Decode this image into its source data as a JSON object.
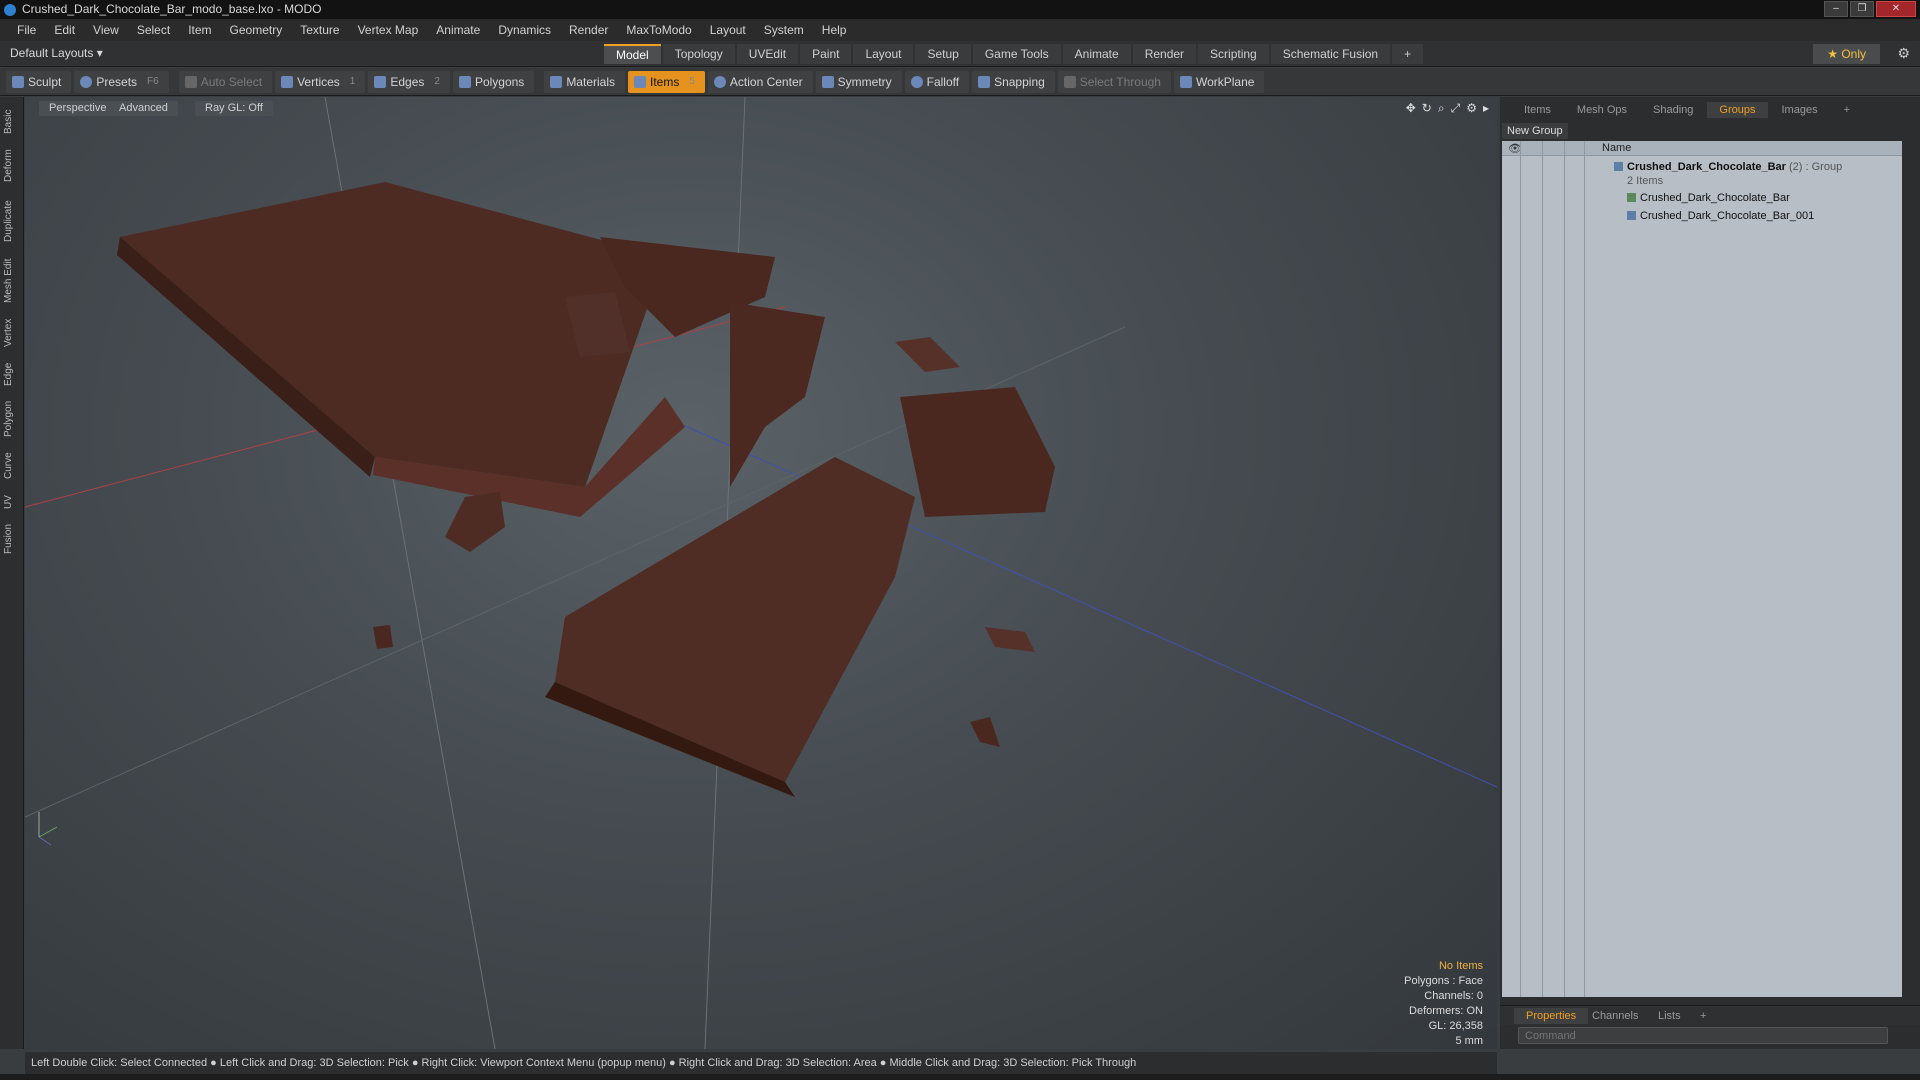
{
  "window": {
    "title": "Crushed_Dark_Chocolate_Bar_modo_base.lxo - MODO",
    "min": "‒",
    "max": "❐",
    "close": "✕"
  },
  "menu": [
    "File",
    "Edit",
    "View",
    "Select",
    "Item",
    "Geometry",
    "Texture",
    "Vertex Map",
    "Animate",
    "Dynamics",
    "Render",
    "MaxToModo",
    "Layout",
    "System",
    "Help"
  ],
  "layoutbar": {
    "title": "Default Layouts ▾",
    "tabs": [
      "Model",
      "Topology",
      "UVEdit",
      "Paint",
      "Layout",
      "Setup",
      "Game Tools",
      "Animate",
      "Render",
      "Scripting",
      "Schematic Fusion"
    ],
    "add": "+",
    "only": "★  Only"
  },
  "toolbar": {
    "sculpt": "Sculpt",
    "presets": "Presets",
    "presets_key": "F6",
    "autoselect": "Auto Select",
    "vertices": "Vertices",
    "vertices_key": "1",
    "edges": "Edges",
    "edges_key": "2",
    "polygons": "Polygons",
    "materials": "Materials",
    "items": "Items",
    "items_key": "5",
    "action_center": "Action Center",
    "symmetry": "Symmetry",
    "falloff": "Falloff",
    "snapping": "Snapping",
    "select_through": "Select Through",
    "workplane": "WorkPlane"
  },
  "lefttabs": [
    "Basic",
    "Deform",
    "Duplicate",
    "Mesh Edit",
    "Vertex",
    "Edge",
    "Polygon",
    "Curve",
    "UV",
    "Fusion"
  ],
  "viewport": {
    "perspective": "Perspective",
    "advanced": "Advanced",
    "raygl": "Ray GL: Off",
    "info": {
      "no_items": "No Items",
      "polygons": "Polygons : Face",
      "channels": "Channels: 0",
      "deformers": "Deformers: ON",
      "gl": "GL: 26,358",
      "unit": "5 mm"
    }
  },
  "rightpanel": {
    "tabs": [
      "Items",
      "Mesh Ops",
      "Shading",
      "Groups",
      "Images",
      "+"
    ],
    "active_tab": "Groups",
    "new_group": "New Group",
    "name_header": "Name",
    "group_name": "Crushed_Dark_Chocolate_Bar",
    "group_suffix": " (2) : Group",
    "group_count": "2 Items",
    "children": [
      "Crushed_Dark_Chocolate_Bar",
      "Crushed_Dark_Chocolate_Bar_001"
    ],
    "bottom_tabs": [
      "Properties",
      "Channels",
      "Lists",
      "+"
    ],
    "command_placeholder": "Command"
  },
  "status": "Left Double Click: Select Connected ● Left Click and Drag: 3D Selection: Pick ● Right Click: Viewport Context Menu (popup menu) ● Right Click and Drag: 3D Selection: Area ● Middle Click and Drag: 3D Selection: Pick Through",
  "colors": {
    "accent": "#f0a020",
    "chocolate": "#4a2a22"
  }
}
